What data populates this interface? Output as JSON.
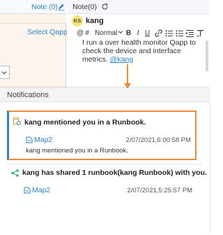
{
  "left_panel": {
    "tab_label": "Note (0)",
    "select_qapp": "Select Qapp"
  },
  "note_panel": {
    "tab_label": "Note(0)",
    "user": {
      "initials": "KS",
      "name": "kang"
    },
    "toolbar": {
      "at": "@",
      "hash": "#",
      "style": "Normal",
      "bold": "B",
      "italic": "I",
      "underline": "U"
    },
    "body_text": "I run a over health monitor Qapp to check the device and interface metrics.",
    "mention": "@kang"
  },
  "notifications": {
    "title": "Notifications",
    "items": [
      {
        "title": "kang mentioned you in a Runbook.",
        "link": "Map2",
        "time": "2/07/2021,6:00:58 PM",
        "message": "kang mentioned you in a Runbook.",
        "icon": "mention-icon"
      },
      {
        "title": "kang has shared 1 runbook(kang Runbook) with you.",
        "link": "Map2",
        "time": "2/07/2021,5:25:57 PM",
        "icon": "share-icon"
      }
    ]
  },
  "colors": {
    "accent_blue": "#2d82c8",
    "highlight_orange": "#ec8a35",
    "share_green": "#3bb273"
  }
}
